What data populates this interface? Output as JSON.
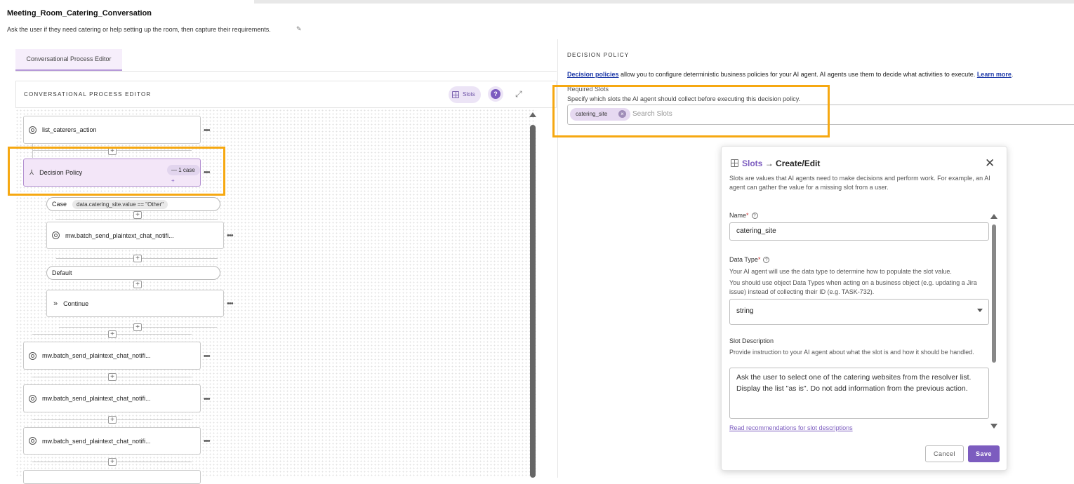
{
  "page": {
    "title": "Meeting_Room_Catering_Conversation",
    "description": "Ask the user if they need catering or help setting up the room, then capture their requirements."
  },
  "tabs": [
    {
      "label": "Conversational Process Editor"
    }
  ],
  "editor": {
    "header": "CONVERSATIONAL PROCESS EDITOR",
    "slots_button": "Slots",
    "help_icon": "?",
    "nodes": {
      "list_caterers": "list_caterers_action",
      "decision_policy": "Decision Policy",
      "case_count": "1 case",
      "case_label": "Case",
      "case_condition": "data.catering_site.value == \"Other\"",
      "case_action": "mw.batch_send_plaintext_chat_notifi...",
      "default_label": "Default",
      "continue": "Continue",
      "notify_1": "mw.batch_send_plaintext_chat_notifi...",
      "notify_2": "mw.batch_send_plaintext_chat_notifi...",
      "notify_3": "mw.batch_send_plaintext_chat_notifi..."
    }
  },
  "decision_policy_panel": {
    "section_title": "DECISION POLICY",
    "desc_link": "Decision policies",
    "desc_text": " allow you to configure deterministic business policies for your AI agent. AI agents use them to decide what activities to execute. ",
    "learn_more": "Learn more",
    "required_slots_label": "Required Slots",
    "required_slots_desc": "Specify which slots the AI agent should collect before executing this decision policy.",
    "selected_slot": "catering_site",
    "search_placeholder": "Search Slots"
  },
  "modal": {
    "title_prefix": "Slots",
    "title_arrow": "→",
    "title_main": "Create/Edit",
    "intro": "Slots are values that AI agents need to make decisions and perform work. For example, an AI agent can gather the value for a missing slot from a user.",
    "name_label": "Name",
    "name_value": "catering_site",
    "data_type_label": "Data Type",
    "data_type_help_1": "Your AI agent will use the data type to determine how to populate the slot value.",
    "data_type_help_2": "You should use object Data Types when acting on a business object (e.g. updating a Jira issue) instead of collecting their ID (e.g. TASK-732).",
    "data_type_value": "string",
    "slot_desc_label": "Slot Description",
    "slot_desc_help": "Provide instruction to your AI agent about what the slot is and how it should be handled.",
    "slot_desc_value": "Ask the user to select one of the catering websites from the resolver list. Display the list \"as is\". Do not add information from the previous action.",
    "recommendations_link": "Read recommendations for slot descriptions",
    "cancel": "Cancel",
    "save": "Save"
  },
  "colors": {
    "accent": "#7c5cbf",
    "highlight": "#f6a811",
    "link": "#1e3aa8"
  }
}
